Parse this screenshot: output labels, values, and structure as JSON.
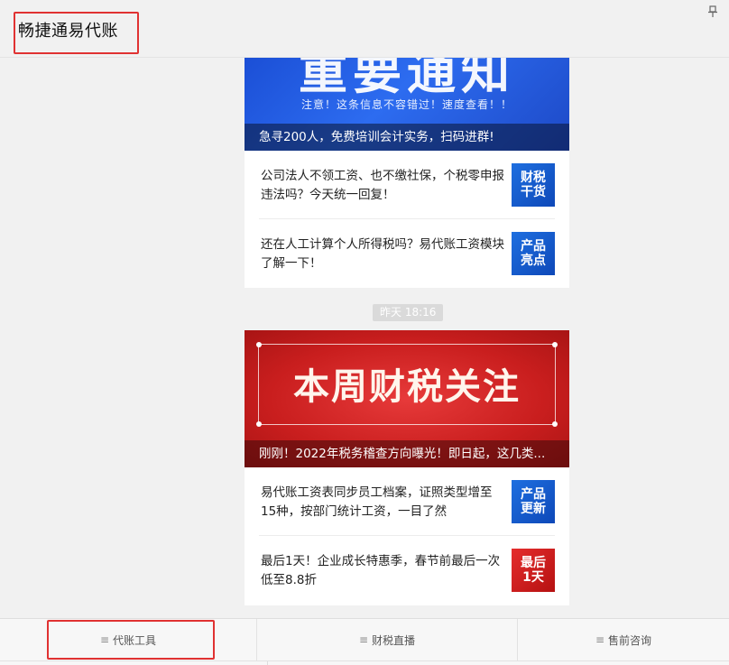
{
  "header": {
    "title": "畅捷通易代账"
  },
  "card1": {
    "banner_big": "重要通知",
    "banner_sub": "注意！这条信息不容错过！速度查看！！",
    "banner_caption": "急寻200人，免费培训会计实务，扫码进群!",
    "items": [
      {
        "text": "公司法人不领工资、也不缴社保，个税零申报违法吗？今天统一回复！",
        "thumb": [
          "财税",
          "干货"
        ]
      },
      {
        "text": "还在人工计算个人所得税吗？易代账工资模块了解一下！",
        "thumb": [
          "产品",
          "亮点"
        ]
      }
    ]
  },
  "timestamp": "昨天 18:16",
  "card2": {
    "banner_big": "本周财税关注",
    "banner_caption": "刚刚！2022年税务稽查方向曝光！即日起，这几类...",
    "items": [
      {
        "text": "易代账工资表同步员工档案，证照类型增至15种，按部门统计工资，一目了然",
        "thumb": [
          "产品",
          "更新"
        ]
      },
      {
        "text": "最后1天！企业成长特惠季，春节前最后一次低至8.8折",
        "thumb": [
          "最后",
          "1天"
        ]
      }
    ]
  },
  "footer": {
    "tabs": [
      {
        "label": "代账工具"
      },
      {
        "label": "财税直播"
      },
      {
        "label": "售前咨询"
      }
    ]
  },
  "colors": {
    "accent_red": "#e03232",
    "banner_blue": "#1b4fd6",
    "banner_red": "#c91e1e"
  }
}
